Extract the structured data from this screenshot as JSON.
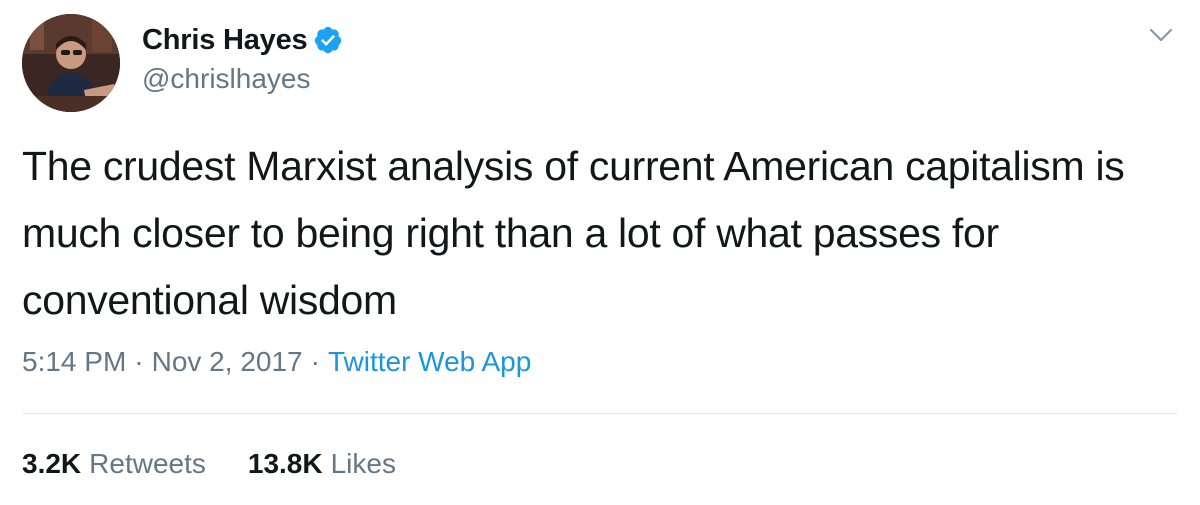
{
  "author": {
    "display_name": "Chris Hayes",
    "handle": "@chrislhayes",
    "verified": true
  },
  "tweet": {
    "text": "The crudest Marxist analysis of current American capitalism is much closer to being right than a lot of what passes for conventional wisdom",
    "time": "5:14 PM",
    "separator": "·",
    "date": "Nov 2, 2017",
    "source": "Twitter Web App"
  },
  "stats": {
    "retweets_count": "3.2K",
    "retweets_label": "Retweets",
    "likes_count": "13.8K",
    "likes_label": "Likes"
  },
  "icons": {
    "verified": "verified-badge-icon",
    "menu": "chevron-down-icon"
  },
  "colors": {
    "text": "#14171a",
    "secondary": "#657786",
    "link": "#1b95e0",
    "verified": "#1da1f2",
    "divider": "#e6ecf0"
  }
}
